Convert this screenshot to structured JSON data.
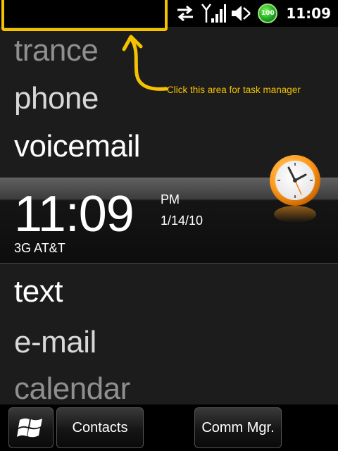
{
  "status_bar": {
    "time": "11:09",
    "battery_label": "100",
    "icons": [
      "data-sync-icon",
      "signal-icon",
      "volume-muted-icon",
      "battery-icon"
    ]
  },
  "annotation": {
    "text": "Click this area for task manager",
    "color": "#f5c200"
  },
  "menu_top": [
    {
      "label": "trance",
      "tone": "dim"
    },
    {
      "label": "phone",
      "tone": "soft"
    },
    {
      "label": "voicemail",
      "tone": "bright"
    }
  ],
  "clock": {
    "time": "11:09",
    "ampm": "PM",
    "date": "1/14/10",
    "carrier": "3G AT&T"
  },
  "menu_bottom": [
    {
      "label": "text",
      "tone": "bright"
    },
    {
      "label": "e-mail",
      "tone": "soft"
    },
    {
      "label": "calendar",
      "tone": "dim"
    }
  ],
  "softkeys": {
    "start_icon": "windows-logo-icon",
    "contacts": "Contacts",
    "comm_mgr": "Comm Mgr."
  }
}
